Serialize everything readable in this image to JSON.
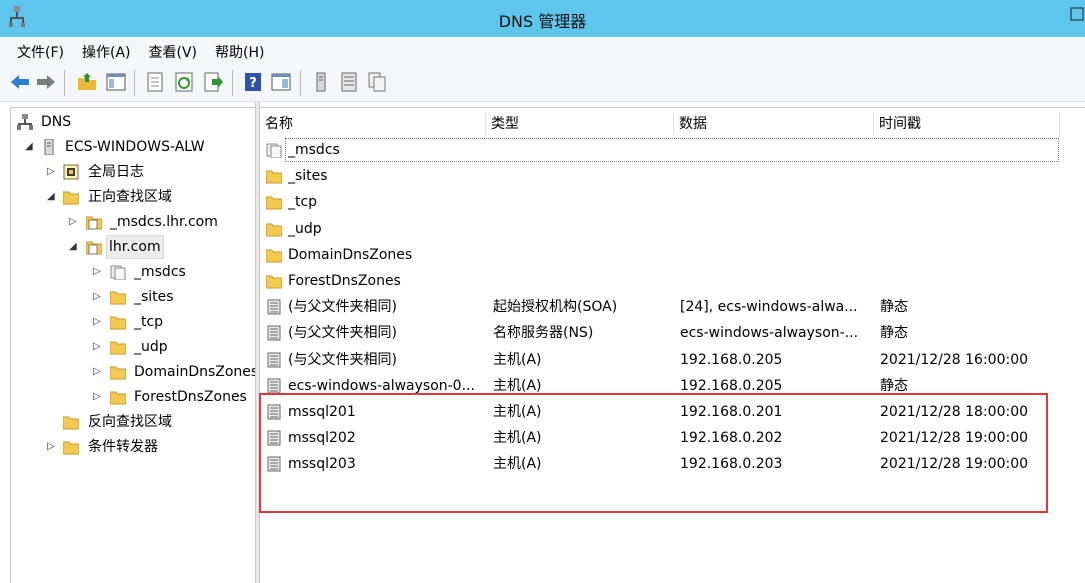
{
  "window": {
    "title": "DNS 管理器"
  },
  "menu": [
    "文件(F)",
    "操作(A)",
    "查看(V)",
    "帮助(H)"
  ],
  "toolbar": {
    "buttons": [
      "back-icon",
      "forward-icon",
      "up-folder-icon",
      "show-hide-tree-icon",
      "properties-icon",
      "refresh-icon",
      "export-list-icon",
      "help-icon",
      "console-view-icon",
      "server-icon",
      "list-icon",
      "copy-icon"
    ]
  },
  "tree": {
    "root": "DNS",
    "server": "ECS-WINDOWS-ALW",
    "global_logs": "全局日志",
    "forward_zones": "正向查找区域",
    "zone_msdcs": "_msdcs.lhr.com",
    "zone_lhr": "lhr.com",
    "sub_msdcs": "_msdcs",
    "sub_sites": "_sites",
    "sub_tcp": "_tcp",
    "sub_udp": "_udp",
    "sub_domaindnszones": "DomainDnsZones",
    "sub_forestdnszones": "ForestDnsZones",
    "reverse_zones": "反向查找区域",
    "conditional_forwarders": "条件转发器"
  },
  "columns": {
    "name": "名称",
    "type": "类型",
    "data": "数据",
    "timestamp": "时间戳"
  },
  "rows": [
    {
      "name": "_msdcs",
      "type": "",
      "data": "",
      "timestamp": "",
      "icon": "delegated-zone-icon"
    },
    {
      "name": "_sites",
      "type": "",
      "data": "",
      "timestamp": "",
      "icon": "folder-icon"
    },
    {
      "name": "_tcp",
      "type": "",
      "data": "",
      "timestamp": "",
      "icon": "folder-icon"
    },
    {
      "name": "_udp",
      "type": "",
      "data": "",
      "timestamp": "",
      "icon": "folder-icon"
    },
    {
      "name": "DomainDnsZones",
      "type": "",
      "data": "",
      "timestamp": "",
      "icon": "folder-icon"
    },
    {
      "name": "ForestDnsZones",
      "type": "",
      "data": "",
      "timestamp": "",
      "icon": "folder-icon"
    },
    {
      "name": "(与父文件夹相同)",
      "type": "起始授权机构(SOA)",
      "data": "[24], ecs-windows-alwa...",
      "timestamp": "静态",
      "icon": "record-icon"
    },
    {
      "name": "(与父文件夹相同)",
      "type": "名称服务器(NS)",
      "data": "ecs-windows-alwayson-...",
      "timestamp": "静态",
      "icon": "record-icon"
    },
    {
      "name": "(与父文件夹相同)",
      "type": "主机(A)",
      "data": "192.168.0.205",
      "timestamp": "2021/12/28 16:00:00",
      "icon": "record-icon"
    },
    {
      "name": "ecs-windows-alwayson-0...",
      "type": "主机(A)",
      "data": "192.168.0.205",
      "timestamp": "静态",
      "icon": "record-icon"
    },
    {
      "name": "mssql201",
      "type": "主机(A)",
      "data": "192.168.0.201",
      "timestamp": "2021/12/28 18:00:00",
      "icon": "record-icon"
    },
    {
      "name": "mssql202",
      "type": "主机(A)",
      "data": "192.168.0.202",
      "timestamp": "2021/12/28 19:00:00",
      "icon": "record-icon"
    },
    {
      "name": "mssql203",
      "type": "主机(A)",
      "data": "192.168.0.203",
      "timestamp": "2021/12/28 19:00:00",
      "icon": "record-icon"
    }
  ],
  "colors": {
    "titlebar": "#5ec5ec",
    "highlight": "#e0393a",
    "folder": "#f3c94f"
  }
}
